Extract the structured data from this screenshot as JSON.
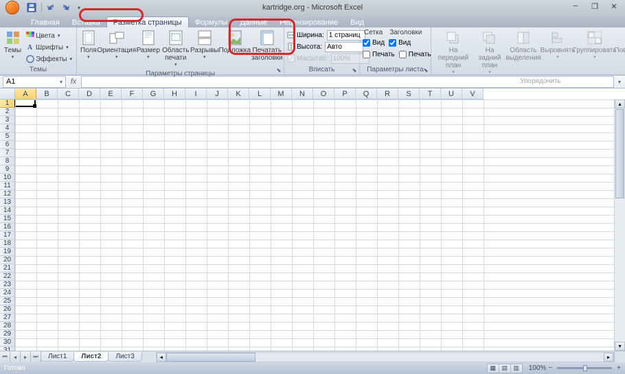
{
  "title": "kartridge.org - Microsoft Excel",
  "tabs": [
    "Главная",
    "Вставка",
    "Разметка страницы",
    "Формулы",
    "Данные",
    "Рецензирование",
    "Вид"
  ],
  "active_tab": 2,
  "themes": {
    "group_label": "Темы",
    "themes_btn": "Темы",
    "colors": "Цвета",
    "fonts": "Шрифты",
    "effects": "Эффекты"
  },
  "page_setup": {
    "group_label": "Параметры страницы",
    "margins": "Поля",
    "orientation": "Ориентация",
    "size": "Размер",
    "print_area": "Область печати",
    "breaks": "Разрывы",
    "background": "Подложка",
    "print_titles": "Печатать заголовки"
  },
  "scale_fit": {
    "group_label": "Вписать",
    "width_lbl": "Ширина:",
    "width_val": "1 страниц",
    "height_lbl": "Высота:",
    "height_val": "Авто",
    "scale_lbl": "Масштаб:",
    "scale_val": "100%"
  },
  "sheet_opts": {
    "group_label": "Параметры листа",
    "gridlines_hdr": "Сетка",
    "headings_hdr": "Заголовки",
    "view": "Вид",
    "print": "Печать"
  },
  "arrange": {
    "group_label": "Упорядочить",
    "bring_fwd": "На передний план",
    "send_back": "На задний план",
    "selection": "Область выделения",
    "align": "Выровнять",
    "group": "Группировать",
    "rotate": "Повернуть"
  },
  "namebox": "A1",
  "columns": [
    "A",
    "B",
    "C",
    "D",
    "E",
    "F",
    "G",
    "H",
    "I",
    "J",
    "K",
    "L",
    "M",
    "N",
    "O",
    "P",
    "Q",
    "R",
    "S",
    "T",
    "U",
    "V"
  ],
  "rows_count": 31,
  "sheets": {
    "items": [
      "Лист1",
      "Лист2",
      "Лист3"
    ],
    "active": 1
  },
  "status": "Готово",
  "zoom": "100%"
}
